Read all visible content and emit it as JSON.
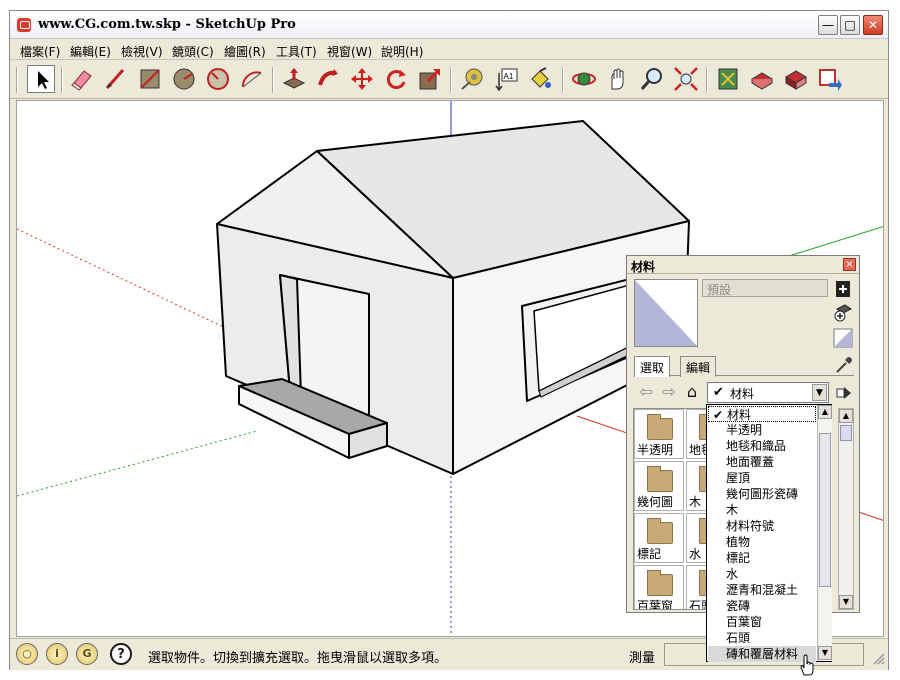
{
  "window": {
    "title": "www.CG.com.tw.skp - SketchUp Pro",
    "min_glyph": "—",
    "max_glyph": "□",
    "close_glyph": "✕"
  },
  "menu": [
    {
      "label": "檔案(F)"
    },
    {
      "label": "編輯(E)"
    },
    {
      "label": "檢視(V)"
    },
    {
      "label": "鏡頭(C)"
    },
    {
      "label": "繪圖(R)"
    },
    {
      "label": "工具(T)"
    },
    {
      "label": "視窗(W)"
    },
    {
      "label": "說明(H)"
    }
  ],
  "toolbar": {
    "tools": [
      "select-icon",
      "eraser-icon",
      "pencil-line-icon",
      "rectangle-icon",
      "circle-icon",
      "polygon-icon",
      "arc-icon",
      "push-pull-icon",
      "follow-me-icon",
      "move-icon",
      "rotate-icon",
      "scale-icon",
      "tape-measure-icon",
      "text-label-icon",
      "paint-bucket-icon",
      "orbit-icon",
      "pan-icon",
      "zoom-icon",
      "zoom-extents-icon",
      "get-models-icon",
      "share-model-icon",
      "get-components-icon",
      "send-to-layout-icon"
    ],
    "text_tool_label": "A1"
  },
  "status": {
    "hint": "選取物件。切換到擴充選取。拖曳滑鼠以選取多項。",
    "measure_label": "測量",
    "measure_value": "",
    "icon_letters": [
      "?",
      "i",
      "G"
    ]
  },
  "materials": {
    "title": "材料",
    "close_glyph": "×",
    "name_field": "預設",
    "tabs": [
      {
        "label": "選取"
      },
      {
        "label": "編輯"
      }
    ],
    "library": "材料",
    "thumb_labels": [
      "半透明",
      "地毯",
      "幾何圖",
      "木",
      "標記",
      "水",
      "百葉窗",
      "石頭"
    ],
    "dropdown": {
      "items": [
        {
          "label": "材料",
          "checked": true
        },
        {
          "label": "半透明"
        },
        {
          "label": "地毯和織品"
        },
        {
          "label": "地面覆蓋"
        },
        {
          "label": "屋頂"
        },
        {
          "label": "幾何圖形瓷磚"
        },
        {
          "label": "木"
        },
        {
          "label": "材料符號"
        },
        {
          "label": "植物"
        },
        {
          "label": "標記"
        },
        {
          "label": "水"
        },
        {
          "label": "瀝青和混凝土"
        },
        {
          "label": "瓷磚"
        },
        {
          "label": "百葉窗"
        },
        {
          "label": "石頭"
        },
        {
          "label": "磚和覆層材料",
          "highlighted": true
        }
      ]
    }
  },
  "colors": {
    "axis_red": "#e03020",
    "axis_green": "#20a020",
    "axis_blue": "#2020c0",
    "face": "#ececec",
    "roof": "#e4e4e4",
    "shadow_side": "#f4f4f4",
    "step_top": "#a8a8a8"
  }
}
